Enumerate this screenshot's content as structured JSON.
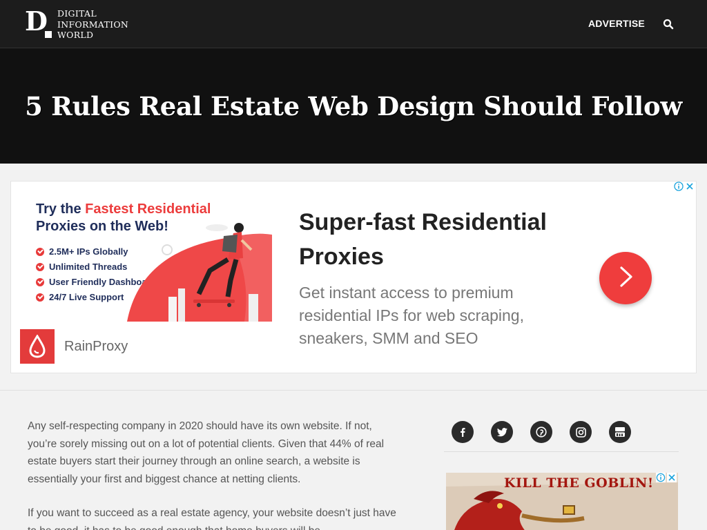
{
  "header": {
    "logo_letter": "D",
    "logo_lines": [
      "DIGITAL",
      "INFORMATION",
      "WORLD"
    ],
    "advertise_label": "ADVERTISE",
    "search_icon": "search-icon"
  },
  "article": {
    "title": "5 Rules Real Estate Web Design Should Follow",
    "paragraphs": [
      "Any self-respecting company in 2020 should have its own website. If not, you’re sorely missing out on a lot of potential clients. Given that 44% of real estate buyers start their journey through an online search, a website is essentially your first and biggest chance at netting clients.",
      "If you want to succeed as a real estate agency, your website doesn’t just have to be good, it has to be good enough that home buyers will be"
    ]
  },
  "ad": {
    "banner_heading_prefix": "Try the ",
    "banner_heading_highlight": "Fastest Residential",
    "banner_heading_suffix": "Proxies on the Web!",
    "features": [
      "2.5M+ IPs Globally",
      "Unlimited Threads",
      "User Friendly Dashboard",
      "24/7 Live Support"
    ],
    "brand_name": "RainProxy",
    "headline": "Super-fast Residential Proxies",
    "description": "Get instant access to premium residential IPs for web scraping, sneakers, SMM and SEO",
    "colors": {
      "accent": "#ef3d3d",
      "navy": "#1f2d5a"
    }
  },
  "sidebar": {
    "social": [
      {
        "name": "facebook",
        "icon": "facebook-icon"
      },
      {
        "name": "twitter",
        "icon": "twitter-icon"
      },
      {
        "name": "pinterest",
        "icon": "pinterest-icon"
      },
      {
        "name": "instagram",
        "icon": "instagram-icon"
      },
      {
        "name": "youtube",
        "icon": "youtube-icon"
      }
    ],
    "ad_title": "KILL THE GOBLIN!"
  }
}
